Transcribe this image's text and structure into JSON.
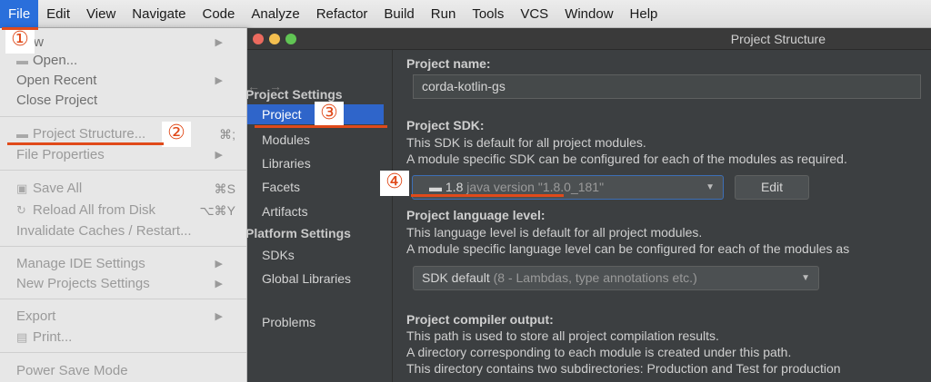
{
  "menubar": {
    "items": [
      {
        "label": "File",
        "active": true
      },
      {
        "label": "Edit"
      },
      {
        "label": "View"
      },
      {
        "label": "Navigate"
      },
      {
        "label": "Code"
      },
      {
        "label": "Analyze"
      },
      {
        "label": "Refactor"
      },
      {
        "label": "Build"
      },
      {
        "label": "Run"
      },
      {
        "label": "Tools"
      },
      {
        "label": "VCS"
      },
      {
        "label": "Window"
      },
      {
        "label": "Help"
      }
    ]
  },
  "file_menu": {
    "new": "New",
    "open": "Open...",
    "open_recent": "Open Recent",
    "close_project": "Close Project",
    "project_structure": "Project Structure...",
    "project_structure_shortcut": "⌘;",
    "file_properties": "File Properties",
    "save_all": "Save All",
    "save_all_shortcut": "⌘S",
    "reload_all": "Reload All from Disk",
    "reload_all_shortcut": "⌥⌘Y",
    "invalidate_caches": "Invalidate Caches / Restart...",
    "manage_ide_settings": "Manage IDE Settings",
    "new_projects_settings": "New Projects Settings",
    "export": "Export",
    "print": "Print...",
    "power_save_mode": "Power Save Mode"
  },
  "dialog": {
    "title": "Project Structure",
    "project_settings_header": "Project Settings",
    "platform_settings_header": "Platform Settings",
    "nav": {
      "project": "Project",
      "modules": "Modules",
      "libraries": "Libraries",
      "facets": "Facets",
      "artifacts": "Artifacts",
      "sdks": "SDKs",
      "global_libraries": "Global Libraries",
      "problems": "Problems"
    },
    "project_name_label": "Project name:",
    "project_name_value": "corda-kotlin-gs",
    "project_sdk_label": "Project SDK:",
    "sdk_desc_1": "This SDK is default for all project modules.",
    "sdk_desc_2": "A module specific SDK can be configured for each of the modules as required.",
    "sdk_value": "1.8",
    "sdk_detail": "java version \"1.8.0_181\"",
    "edit_button": "Edit",
    "language_level_label": "Project language level:",
    "lang_desc_1": "This language level is default for all project modules.",
    "lang_desc_2": "A module specific language level can be configured for each of the modules as",
    "lang_value": "SDK default",
    "lang_detail": "(8 - Lambdas, type annotations etc.)",
    "compiler_output_label": "Project compiler output:",
    "compiler_desc_1": "This path is used to store all project compilation results.",
    "compiler_desc_2": "A directory corresponding to each module is created under this path.",
    "compiler_desc_3": "This directory contains two subdirectories: Production and Test for production"
  },
  "annotations": {
    "step1": "①",
    "step2": "②",
    "step3": "③",
    "step4": "④",
    "color": "#e04a1a"
  },
  "colors": {
    "selection": "#2f65ca",
    "menu_active": "#2a6fdb",
    "traffic_close": "#ec6a5e",
    "traffic_min": "#f4bf4f",
    "traffic_max": "#61c554"
  }
}
